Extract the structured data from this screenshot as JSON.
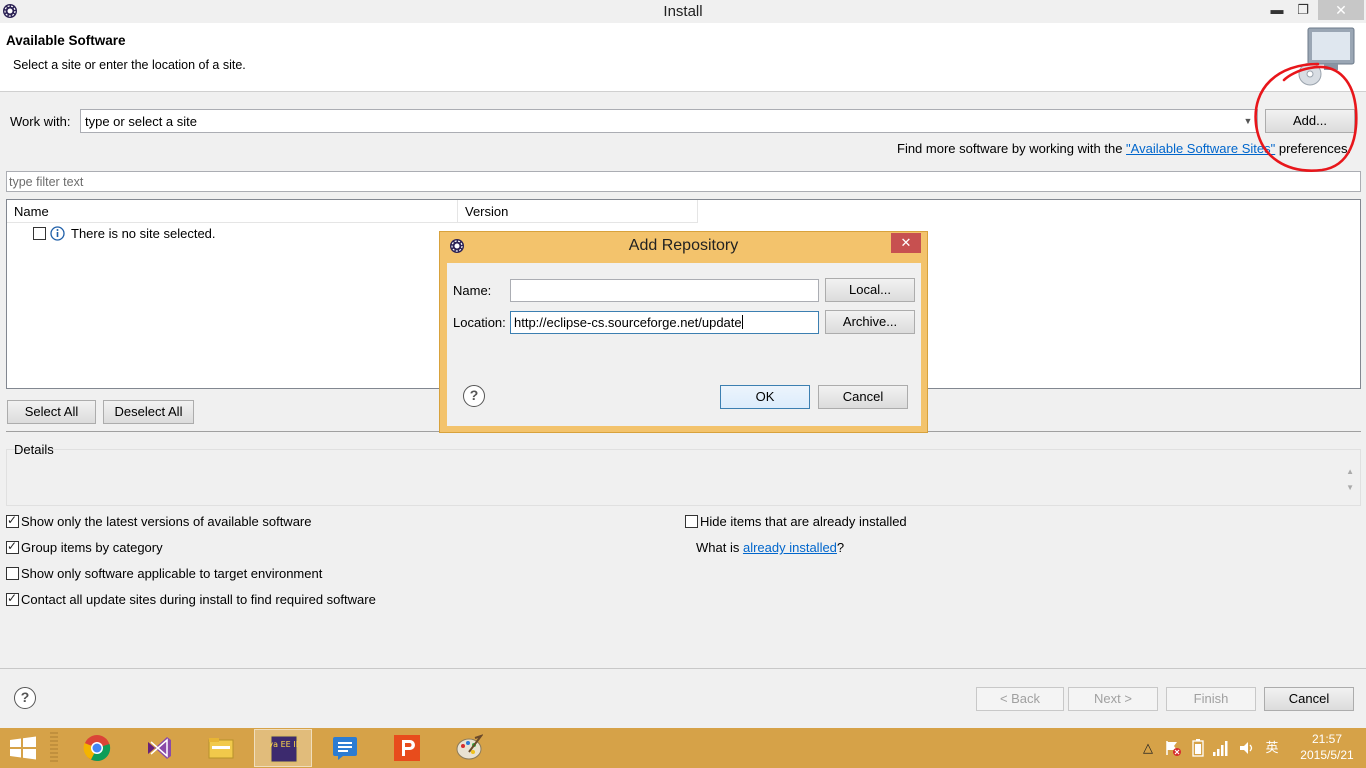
{
  "window": {
    "title": "Install",
    "minimize_glyph": "▬",
    "maximize_glyph": "❐",
    "close_glyph": "✕"
  },
  "header": {
    "title": "Available Software",
    "subtitle": "Select a site or enter the location of a site."
  },
  "work_with": {
    "label": "Work with:",
    "value": "type or select a site",
    "add_button": "Add..."
  },
  "find_more": {
    "prefix": "Find more software by working with the ",
    "link": "\"Available Software Sites\"",
    "suffix": " preferences."
  },
  "filter": {
    "placeholder": "type filter text"
  },
  "table": {
    "columns": [
      "Name",
      "Version"
    ],
    "empty_message": "There is no site selected."
  },
  "selection_buttons": {
    "select_all": "Select All",
    "deselect_all": "Deselect All"
  },
  "details": {
    "label": "Details"
  },
  "options": {
    "latest_versions": {
      "label": "Show only the latest versions of available software",
      "checked": true
    },
    "group_by_category": {
      "label": "Group items by category",
      "checked": true
    },
    "target_env": {
      "label": "Show only software applicable to target environment",
      "checked": false
    },
    "contact_sites": {
      "label": "Contact all update sites during install to find required software",
      "checked": true
    },
    "hide_installed": {
      "label": "Hide items that are already installed",
      "checked": false
    }
  },
  "what_is": {
    "prefix": "What is ",
    "link": "already installed",
    "suffix": "?"
  },
  "wizard_buttons": {
    "back": "< Back",
    "next": "Next >",
    "finish": "Finish",
    "cancel": "Cancel"
  },
  "dialog": {
    "title": "Add Repository",
    "close_glyph": "✕",
    "name_label": "Name:",
    "name_value": "",
    "location_label": "Location:",
    "location_value": "http://eclipse-cs.sourceforge.net/update",
    "local_button": "Local...",
    "archive_button": "Archive...",
    "ok_button": "OK",
    "cancel_button": "Cancel"
  },
  "taskbar": {
    "ime": "英",
    "time": "21:57",
    "date": "2015/5/21",
    "java_ee_label": "Java EE IDE"
  },
  "colors": {
    "taskbar": "#d6a248",
    "dialog_frame": "#f3c36c",
    "link": "#0066cc",
    "annotation": "#e8161b"
  }
}
